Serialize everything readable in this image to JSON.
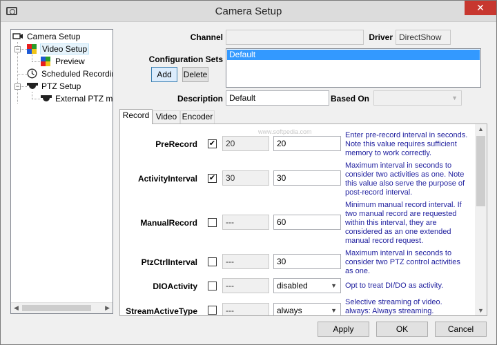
{
  "window": {
    "title": "Camera Setup",
    "close_glyph": "✕"
  },
  "tree": {
    "items": [
      {
        "label": "Camera Setup",
        "icon": "camera-icon"
      },
      {
        "label": "Video Setup",
        "icon": "video-grid-icon",
        "selected": true
      },
      {
        "label": "Preview",
        "icon": "preview-grid-icon"
      },
      {
        "label": "Scheduled Recording",
        "icon": "clock-icon"
      },
      {
        "label": "PTZ Setup",
        "icon": "ptz-dome-icon"
      },
      {
        "label": "External PTZ mod",
        "icon": "ptz-dome-icon"
      }
    ]
  },
  "form": {
    "channel_label": "Channel",
    "channel_value": "",
    "driver_label": "Driver",
    "driver_value": "DirectShow",
    "config_sets_label": "Configuration Sets",
    "config_sets_items": [
      "Default"
    ],
    "add_label": "Add",
    "delete_label": "Delete",
    "description_label": "Description",
    "description_value": "Default",
    "based_on_label": "Based On",
    "based_on_value": ""
  },
  "tabs": [
    {
      "label": "Record",
      "active": true
    },
    {
      "label": "Video",
      "active": false
    },
    {
      "label": "Encoder",
      "active": false
    }
  ],
  "watermark": "www.softpedia.com",
  "record_params": [
    {
      "name": "PreRecord",
      "checked": true,
      "default": "20",
      "value": "20",
      "desc": "Enter pre-record interval in seconds. Note this value requires sufficient memory to work correctly."
    },
    {
      "name": "ActivityInterval",
      "checked": true,
      "default": "30",
      "value": "30",
      "desc": "Maximum interval in seconds to consider two activities as one. Note this value also serve the purpose of post-record interval."
    },
    {
      "name": "ManualRecord",
      "checked": false,
      "default": "---",
      "value": "60",
      "desc": "Minimum manual record interval. If two manual record are requested within this interval, they are considered as an one extended manual record request."
    },
    {
      "name": "PtzCtrlInterval",
      "checked": false,
      "default": "---",
      "value": "30",
      "desc": "Maximum interval in seconds to consider two PTZ control activities as one."
    },
    {
      "name": "DIOActivity",
      "checked": false,
      "default": "---",
      "value": "disabled",
      "desc": "Opt to treat DI/DO as activity."
    },
    {
      "name": "StreamActiveType",
      "checked": false,
      "default": "---",
      "value": "always",
      "desc": "Selective streaming of video. always: Always streaming. view_only: Only"
    }
  ],
  "buttons": {
    "apply": "Apply",
    "ok": "OK",
    "cancel": "Cancel"
  },
  "colors": {
    "selection": "#3399ff",
    "description_text": "#1f1f9e",
    "close": "#c7372f"
  }
}
